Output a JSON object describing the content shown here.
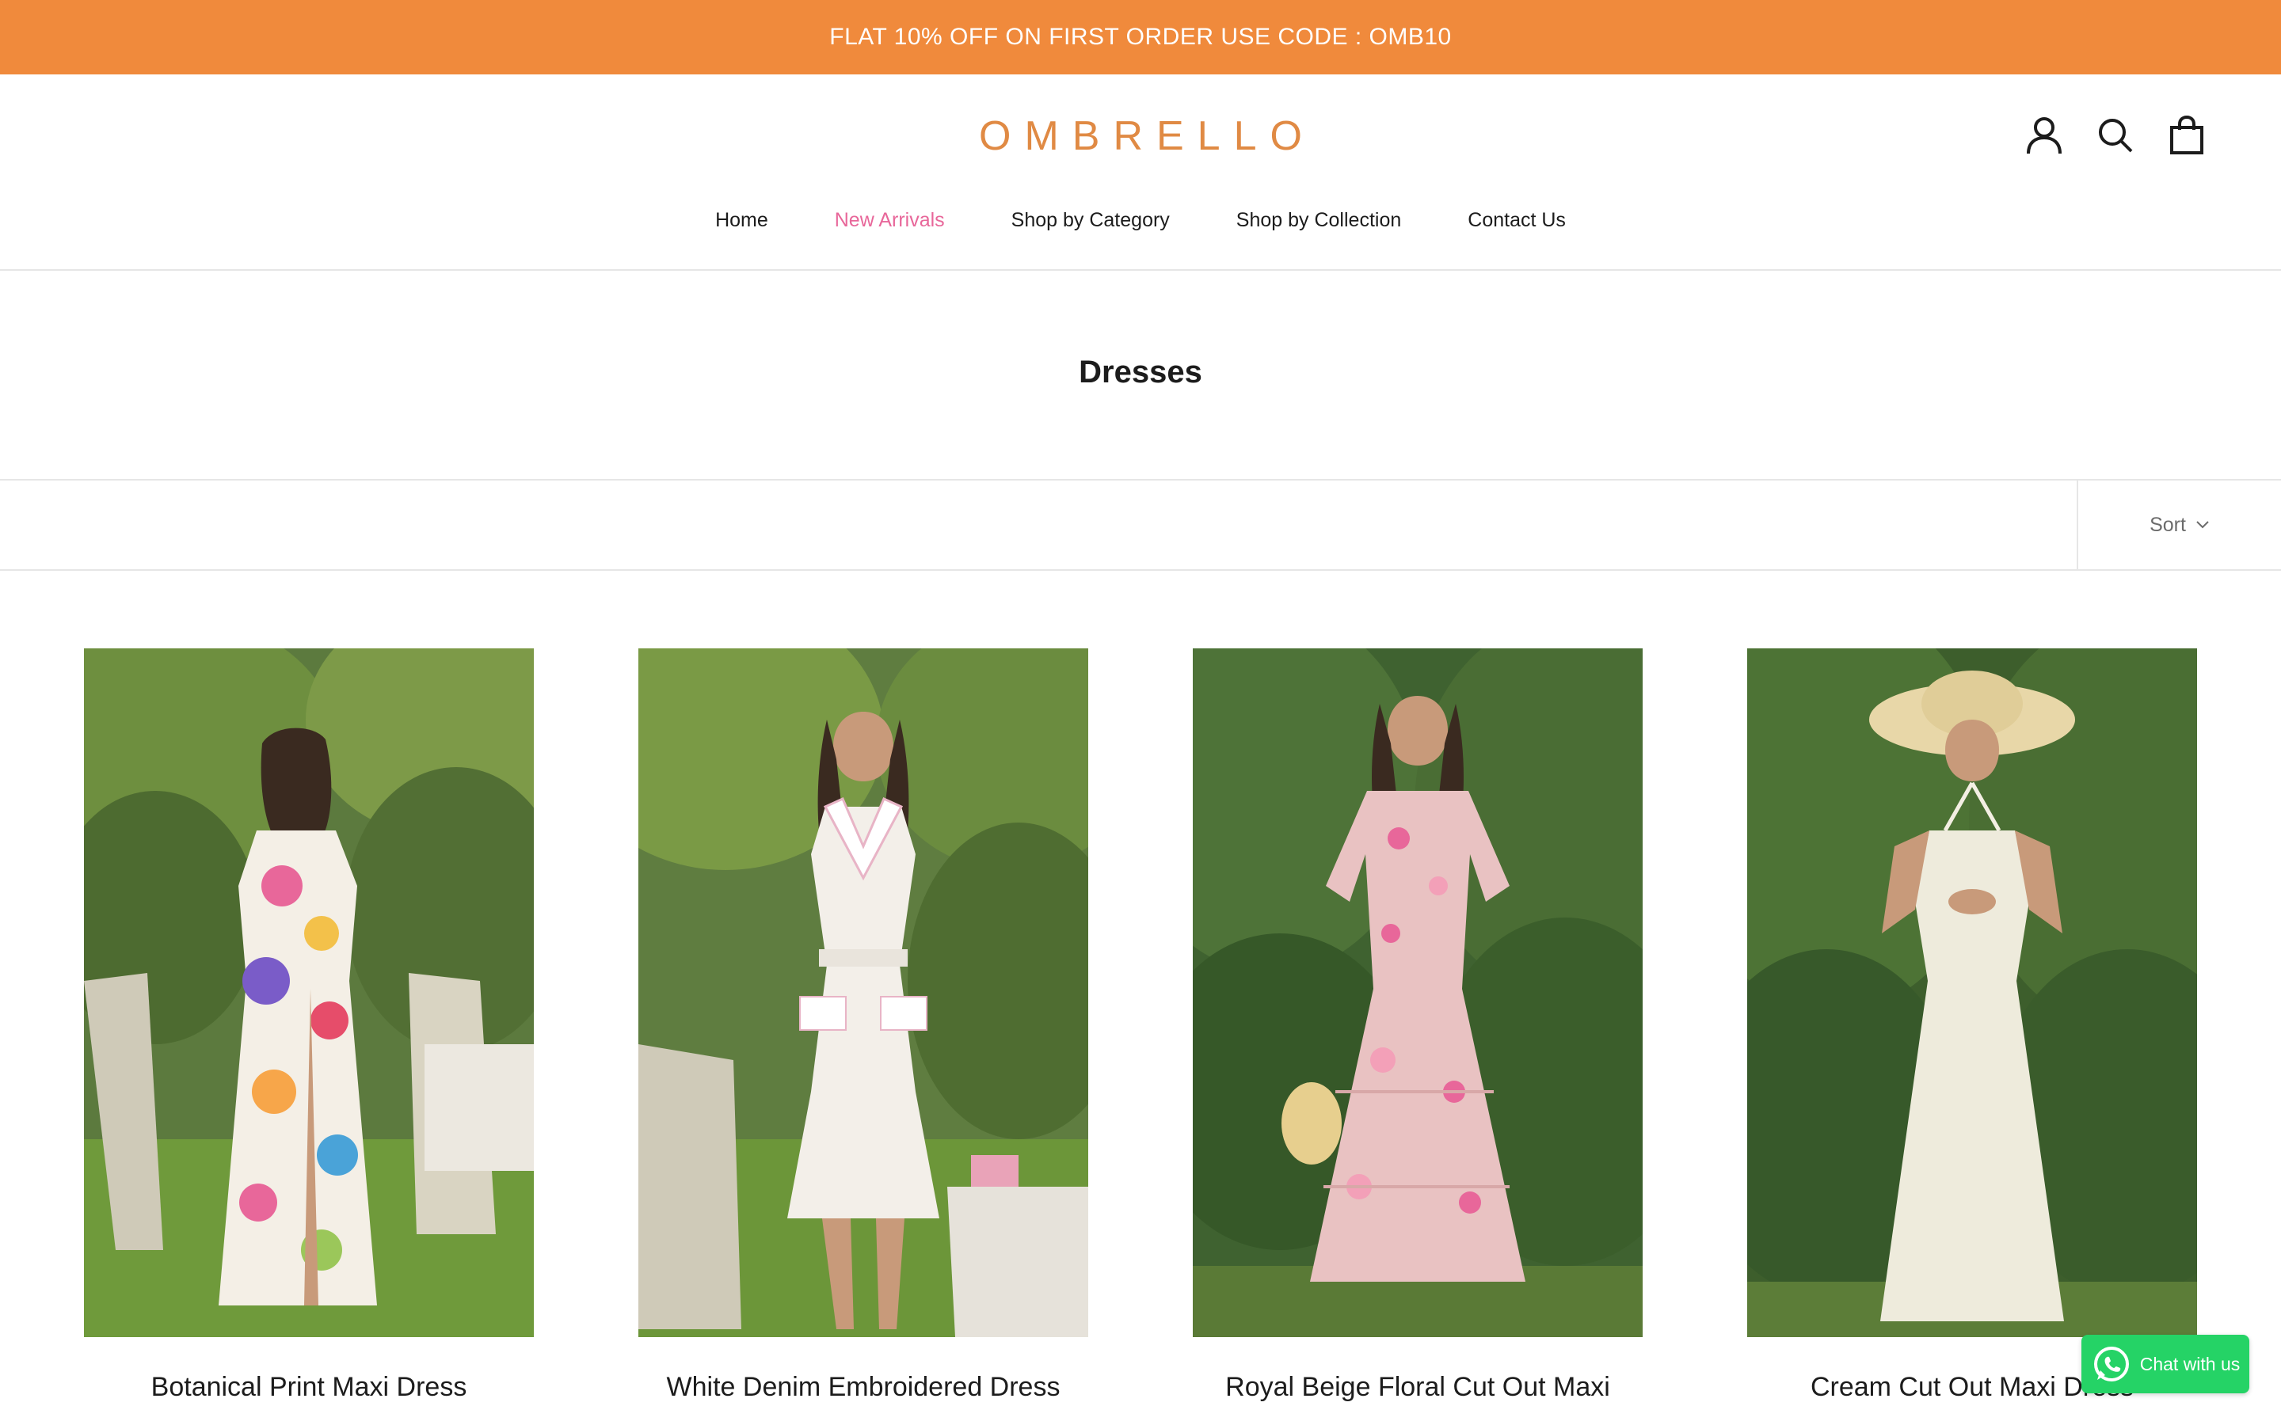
{
  "promo": {
    "text": "FLAT 10% OFF ON FIRST ORDER USE CODE : OMB10"
  },
  "header": {
    "logo": "OMBRELLO",
    "icons": [
      "account-icon",
      "search-icon",
      "shopping-bag-icon"
    ]
  },
  "nav": {
    "items": [
      {
        "label": "Home"
      },
      {
        "label": "New Arrivals",
        "active": true
      },
      {
        "label": "Shop by Category"
      },
      {
        "label": "Shop by Collection"
      },
      {
        "label": "Contact Us"
      }
    ]
  },
  "collection": {
    "title": "Dresses"
  },
  "toolbar": {
    "sort_label": "Sort"
  },
  "products": [
    {
      "title": "Botanical Print Maxi Dress"
    },
    {
      "title": "White Denim Embroidered Dress"
    },
    {
      "title": "Royal Beige Floral Cut Out Maxi"
    },
    {
      "title": "Cream Cut Out Maxi Dress"
    }
  ],
  "chat": {
    "label": "Chat with us"
  },
  "colors": {
    "promo": "#f08a3c",
    "logo": "#e08a44",
    "active_nav": "#e8679a",
    "chat": "#25d366"
  }
}
